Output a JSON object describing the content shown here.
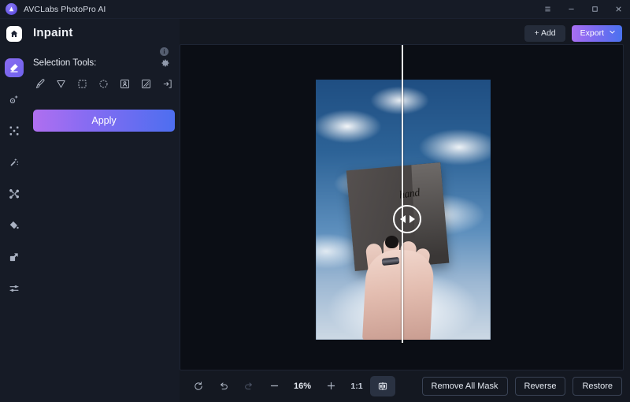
{
  "titlebar": {
    "app_name": "AVCLabs PhotoPro AI",
    "logo_icon": "avclabs-logo-icon",
    "menu_icon": "hamburger-menu-icon",
    "minimize_icon": "minimize-icon",
    "maximize_icon": "maximize-icon",
    "close_icon": "close-icon"
  },
  "rail": {
    "home_icon": "home-icon",
    "items": [
      {
        "name": "inpaint",
        "icon": "eraser-icon",
        "active": true
      },
      {
        "name": "ai-enhance",
        "icon": "ai-sparkle-icon",
        "active": false
      },
      {
        "name": "upscale",
        "icon": "expand-corners-icon",
        "active": false
      },
      {
        "name": "retouch",
        "icon": "magic-wand-icon",
        "active": false
      },
      {
        "name": "background",
        "icon": "scissors-icon",
        "active": false
      },
      {
        "name": "colorize",
        "icon": "paint-bucket-icon",
        "active": false
      },
      {
        "name": "resize",
        "icon": "resize-icon",
        "active": false
      },
      {
        "name": "adjust",
        "icon": "sliders-icon",
        "active": false
      }
    ]
  },
  "panel": {
    "title": "Inpaint",
    "info_badge": "i",
    "section_label": "Selection Tools:",
    "settings_icon": "gear-icon",
    "tools": [
      {
        "label": "Brush",
        "icon": "brush-icon"
      },
      {
        "label": "Lasso",
        "icon": "cursor-arrow-icon"
      },
      {
        "label": "Rectangle Select",
        "icon": "rectangle-icon"
      },
      {
        "label": "Ellipse Select",
        "icon": "ellipse-icon"
      },
      {
        "label": "Subject Select",
        "icon": "person-frame-icon"
      },
      {
        "label": "Pattern Select",
        "icon": "hatched-square-icon"
      },
      {
        "label": "Import Mask",
        "icon": "arrow-into-box-icon"
      }
    ],
    "apply_label": "Apply"
  },
  "topbar": {
    "add_label": "+ Add",
    "add_icon": "plus-icon",
    "export_label": "Export",
    "export_caret_icon": "chevron-down-icon"
  },
  "canvas": {
    "image_alt": "Hand holding a dark stone slab against a blue cloudy sky",
    "scribble_text": "hand",
    "slider_handle_icon": "left-right-arrows-icon",
    "divider_color": "#ffffff"
  },
  "bottombar": {
    "reset_icon": "reset-icon",
    "undo_icon": "undo-icon",
    "redo_icon": "redo-icon",
    "zoom_out_icon": "minus-icon",
    "zoom_level": "16%",
    "zoom_in_icon": "plus-icon",
    "fit_ratio": "1:1",
    "compare_icon": "split-compare-icon",
    "remove_all_mask_label": "Remove All Mask",
    "reverse_label": "Reverse",
    "restore_label": "Restore"
  },
  "colors": {
    "accent_start": "#a96ef2",
    "accent_end": "#4a72ef",
    "panel_bg": "#161b26",
    "canvas_bg": "#0b0e15",
    "app_bg": "#141821"
  }
}
